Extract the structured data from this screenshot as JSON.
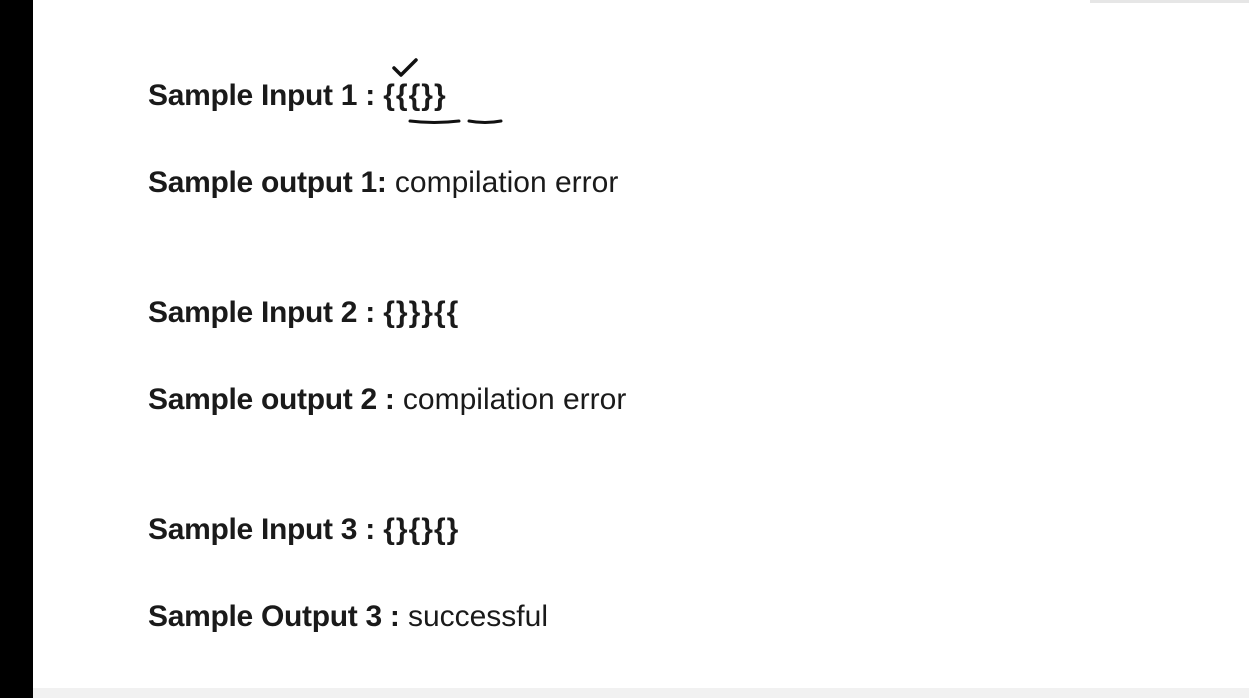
{
  "samples": [
    {
      "input_label": "Sample Input 1 :",
      "input_value": "{{{}}",
      "output_label": "Sample output 1:",
      "output_value": "compilation error"
    },
    {
      "input_label": "Sample Input 2 :",
      "input_value": "{}}}{{",
      "output_label": "Sample output 2 :",
      "output_value": "compilation error"
    },
    {
      "input_label": "Sample Input 3 :",
      "input_value": "{}{}{}",
      "output_label": "Sample Output 3 :",
      "output_value": "successful"
    }
  ],
  "annotations": {
    "pen_color": "#111111",
    "checkmark_icon": "checkmark-icon",
    "underline_marks": [
      "underline-mark-1",
      "underline-mark-2"
    ]
  }
}
